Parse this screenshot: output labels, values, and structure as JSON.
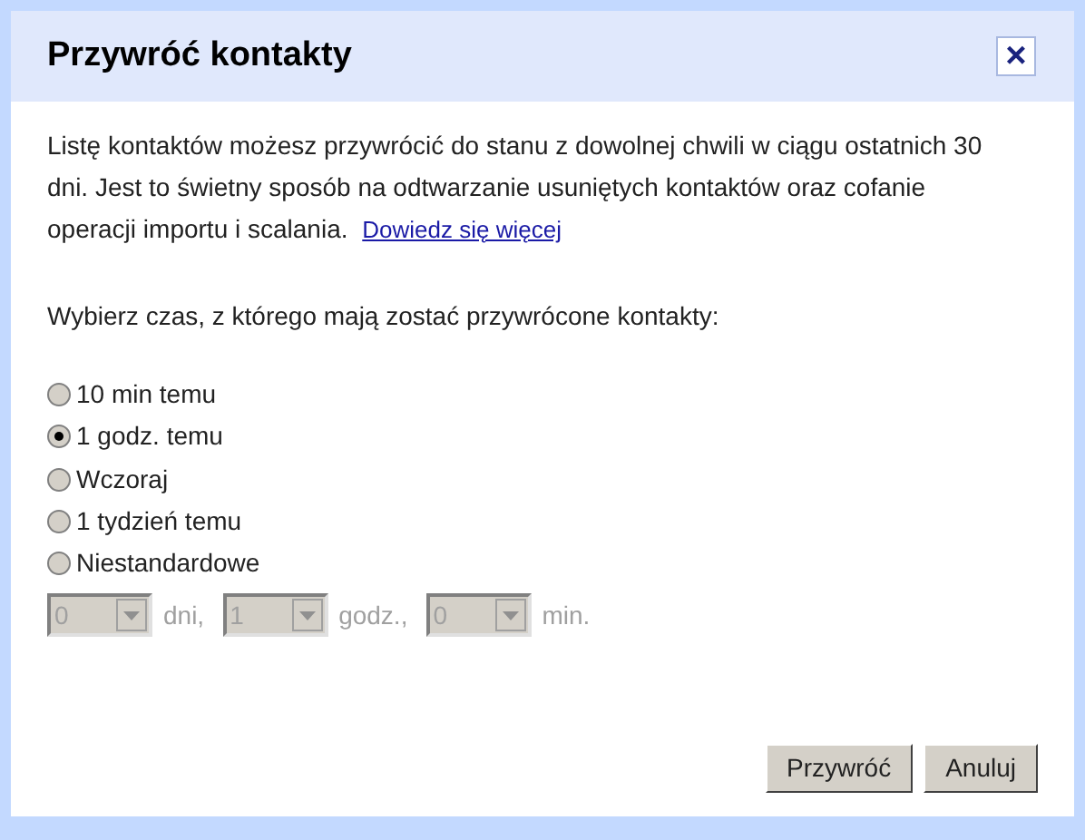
{
  "dialog": {
    "title": "Przywróć kontakty",
    "close": "×"
  },
  "intro": "Listę kontaktów możesz przywrócić do stanu z dowolnej chwili w ciągu ostatnich 30 dni. Jest to świetny sposób na odtwarzanie usuniętych kontaktów oraz cofanie operacji importu i scalania.",
  "learn_more_link": "Dowiedz się więcej",
  "prompt": "Wybierz czas, z którego mają zostać przywrócone kontakty:",
  "options": [
    {
      "label": "10 min temu",
      "selected": false
    },
    {
      "label": "1 godz. temu",
      "selected": true
    },
    {
      "label": "Wczoraj",
      "selected": false
    },
    {
      "label": "1 tydzień temu",
      "selected": false
    },
    {
      "label": "Niestandardowe",
      "selected": false
    }
  ],
  "custom_fields": [
    {
      "value": "0",
      "unit": "dni,",
      "disabled": true
    },
    {
      "value": "1",
      "unit": "godz.,",
      "disabled": true
    },
    {
      "value": "0",
      "unit": "min.",
      "disabled": true
    }
  ],
  "buttons": [
    "Przywróć",
    "Anuluj"
  ]
}
